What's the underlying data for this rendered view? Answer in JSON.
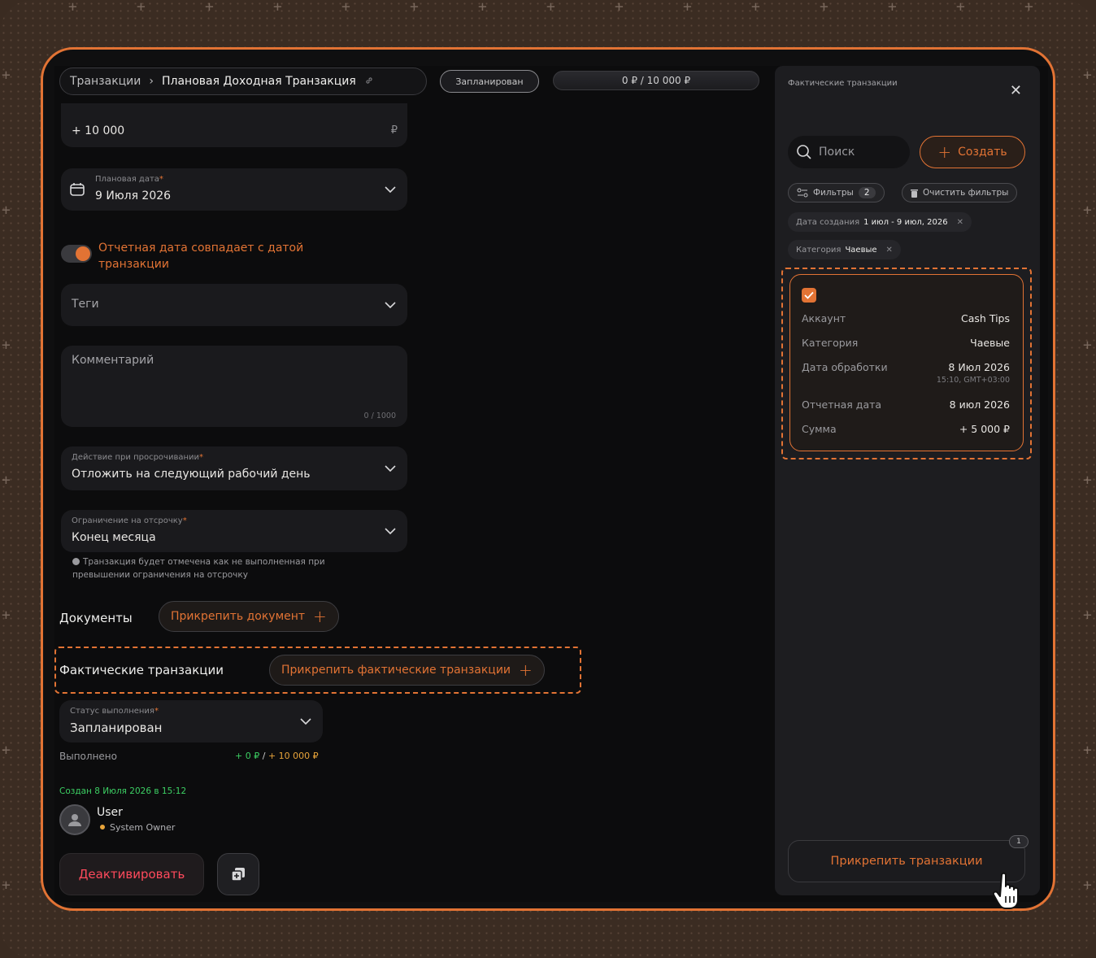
{
  "header": {
    "breadcrumb": [
      "Транзакции",
      "Плановая Доходная Транзакция"
    ],
    "status_pill": "Запланирован",
    "progress": "0 ₽ / 10 000 ₽",
    "progress_fraction": 0
  },
  "form": {
    "amount": {
      "value": "+ 10 000",
      "currency": "₽"
    },
    "planned_date": {
      "label": "Плановая дата",
      "value": "9 Июля 2026"
    },
    "report_toggle": {
      "label": "Отчетная дата совпадает с датой транзакции",
      "on": true
    },
    "tags": {
      "placeholder": "Теги"
    },
    "comment": {
      "placeholder": "Комментарий",
      "counter": "0 / 1000"
    },
    "overdue_action": {
      "label": "Действие при просрочивании",
      "value": "Отложить на следующий рабочий день"
    },
    "deferral_limit": {
      "label": "Ограничение на отсрочку",
      "value": "Конец месяца"
    },
    "hint": "Транзакция будет отмечена как не выполненная при превышении ограничения на отсрочку"
  },
  "documents": {
    "title": "Документы",
    "attach_label": "Прикрепить документ"
  },
  "actual": {
    "title": "Фактические транзакции",
    "attach_label": "Прикрепить фактические транзакции"
  },
  "execution": {
    "label": "Статус выполнения",
    "value": "Запланирован",
    "done_label": "Выполнено",
    "done_value": "+ 0 ₽",
    "done_sep": "/",
    "done_total": "+ 10 000 ₽"
  },
  "meta": {
    "created": "Создан 8 Июля 2026 в 15:12",
    "user_name": "User",
    "user_role": "System Owner"
  },
  "actions": {
    "deactivate": "Деактивировать"
  },
  "panel": {
    "title": "Фактические транзакции",
    "search_placeholder": "Поиск",
    "create_label": "Создать",
    "filters_label": "Фильтры",
    "filters_count": "2",
    "clear_filters": "Очистить фильтры",
    "tags": [
      {
        "key": "Дата создания",
        "value": "1 июл - 9 июл, 2026"
      },
      {
        "key": "Категория",
        "value": "Чаевые"
      }
    ],
    "card": {
      "checked": true,
      "rows": [
        {
          "k": "Аккаунт",
          "v": "Cash Tips"
        },
        {
          "k": "Категория",
          "v": "Чаевые"
        },
        {
          "k": "Дата обработки",
          "v": "8 Июл 2026",
          "sub": "15:10, GMT+03:00"
        },
        {
          "k": "Отчетная дата",
          "v": "8 июл 2026"
        },
        {
          "k": "Сумма",
          "v": "+ 5 000 ₽"
        }
      ]
    },
    "attach_label": "Прикрепить транзакции",
    "attach_badge": "1"
  },
  "colors": {
    "accent": "#e27334",
    "positive": "#3ccf63",
    "danger": "#ff4a5c",
    "background": "#0c0c0d",
    "panel": "#1d1d20"
  },
  "icons": [
    "chevron-right-icon",
    "link-icon",
    "calendar-icon",
    "chevron-down-icon",
    "plus-icon",
    "info-icon",
    "avatar-icon",
    "copy-add-icon",
    "close-icon",
    "search-icon",
    "filter-icon",
    "trash-icon",
    "check-icon",
    "hand-cursor-icon"
  ]
}
